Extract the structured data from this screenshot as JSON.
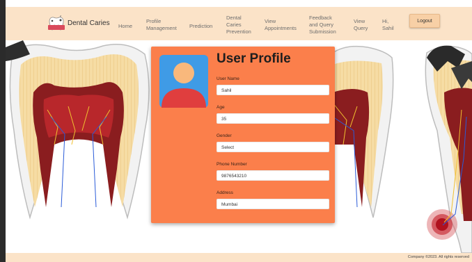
{
  "brand": {
    "name": "Dental Caries"
  },
  "nav": {
    "home": "Home",
    "profile_line1": "Profile",
    "profile_line2": "Management",
    "prediction": "Prediction",
    "prevention_line1": "Dental",
    "prevention_line2": "Caries",
    "prevention_line3": "Prevention",
    "appointments_line1": "View",
    "appointments_line2": "Appointments",
    "feedback_line1": "Feedback",
    "feedback_line2": "and Query",
    "feedback_line3": "Submission",
    "viewquery_line1": "View",
    "viewquery_line2": "Query",
    "greeting_line1": "Hi,",
    "greeting_line2": "Sahil",
    "logout": "Logout"
  },
  "profile": {
    "title": "User Profile",
    "fields": [
      {
        "label": "User Name",
        "value": "Sahil"
      },
      {
        "label": "Age",
        "value": "35"
      },
      {
        "label": "Gender",
        "value": "Select"
      },
      {
        "label": "Phone Number",
        "value": "9876543210"
      },
      {
        "label": "Address",
        "value": "Mumbai"
      }
    ]
  },
  "footer": {
    "text": "Company ©2023. All rights reserved"
  },
  "colors": {
    "navbar": "#fbe3c8",
    "card": "#fb7f4b",
    "logout": "#f8d0a6"
  }
}
